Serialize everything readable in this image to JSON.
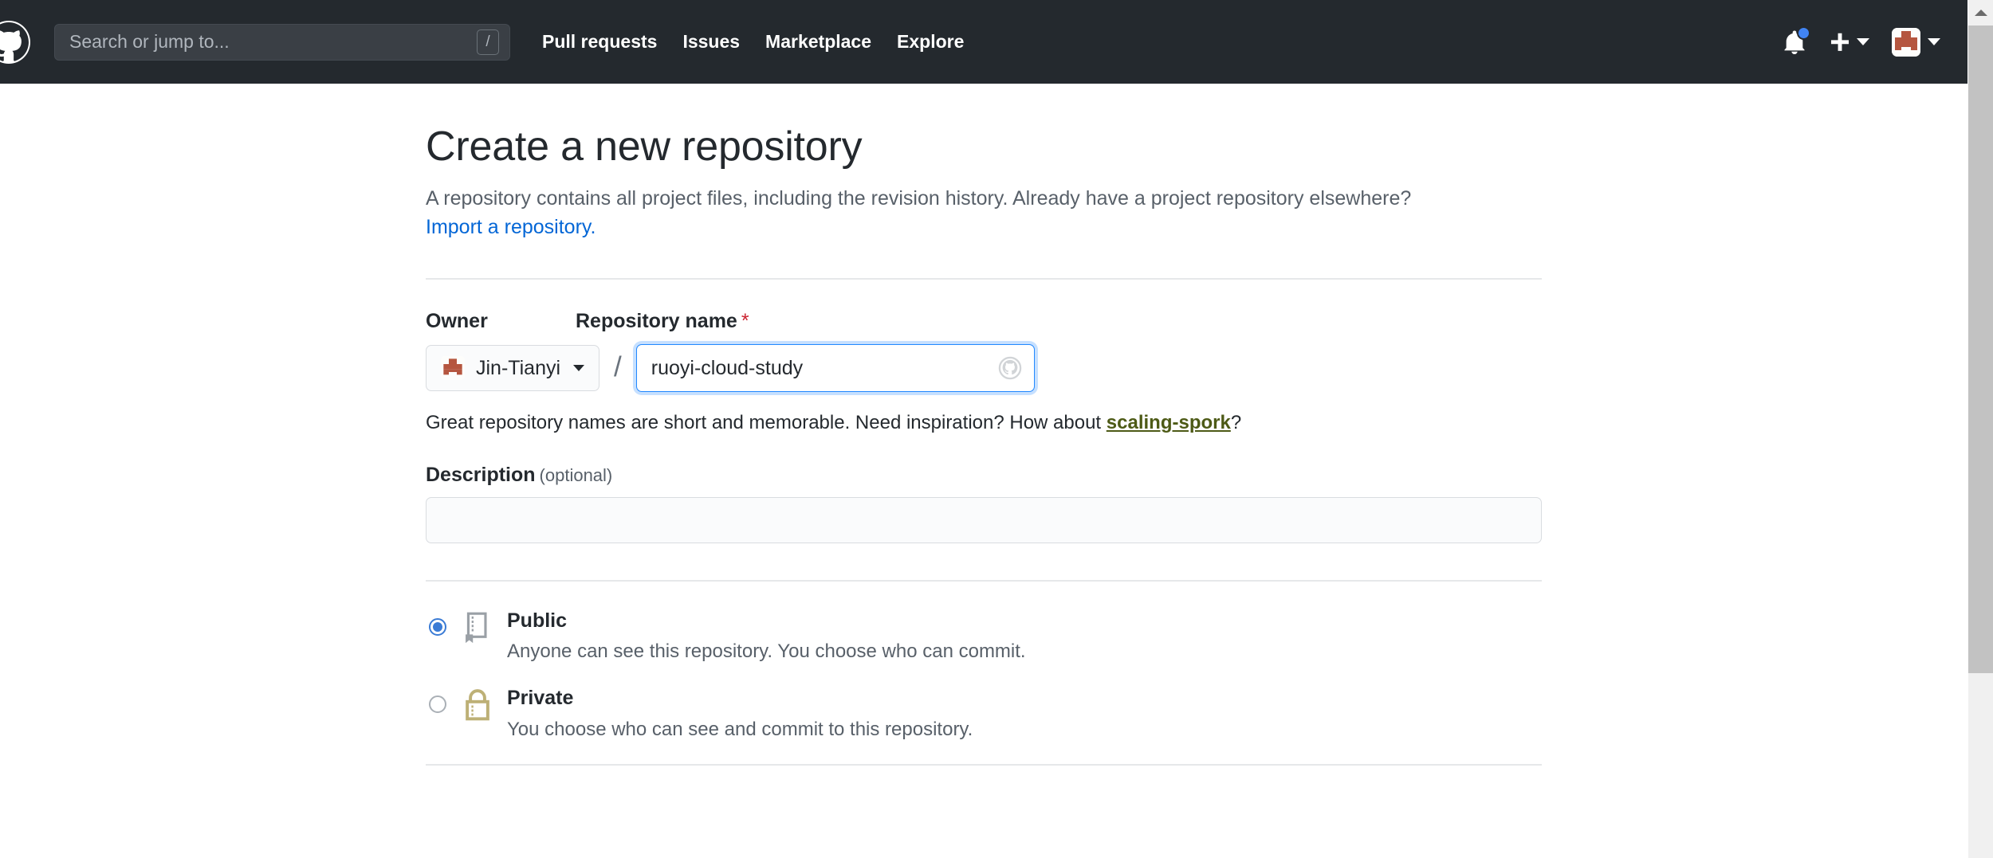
{
  "header": {
    "logo_icon": "github-octocat-logo",
    "search": {
      "placeholder": "Search or jump to...",
      "value": "",
      "shortcut_key": "/"
    },
    "nav": [
      {
        "label": "Pull requests",
        "name": "nav-pull-requests"
      },
      {
        "label": "Issues",
        "name": "nav-issues"
      },
      {
        "label": "Marketplace",
        "name": "nav-marketplace"
      },
      {
        "label": "Explore",
        "name": "nav-explore"
      }
    ],
    "notifications_icon": "bell-icon",
    "notifications_unread": true,
    "create_new_icon": "plus-icon",
    "profile_icon": "avatar-identicon",
    "colors": {
      "header_bg": "#24292e",
      "unread_dot": "#4184f3"
    }
  },
  "page": {
    "title": "Create a new repository",
    "subtitle_before_link": "A repository contains all project files, including the revision history. Already have a project repository elsewhere?",
    "import_link": "Import a repository."
  },
  "form": {
    "owner": {
      "label": "Owner",
      "selected": "Jin-Tianyi",
      "avatar_icon": "identicon-avatar",
      "caret_icon": "chevron-down-icon"
    },
    "separator": "/",
    "repo_name": {
      "label": "Repository name",
      "required_marker": "*",
      "value": "ruoyi-cloud-study",
      "placeholder": "",
      "status_icon": "octocat-spinner-icon"
    },
    "hint": {
      "prefix": "Great repository names are short and memorable. Need inspiration? How about ",
      "suggestion": "scaling-spork",
      "suffix": "?",
      "suggestion_color": "#4d5a16"
    },
    "description": {
      "label": "Description",
      "optional_note": "(optional)",
      "value": "",
      "placeholder": ""
    },
    "visibility": {
      "options": [
        {
          "name": "public",
          "title": "Public",
          "description": "Anyone can see this repository. You choose who can commit.",
          "icon": "repo-book-icon",
          "icon_color": "#9aa0a6",
          "selected": true
        },
        {
          "name": "private",
          "title": "Private",
          "description": "You choose who can see and commit to this repository.",
          "icon": "lock-icon",
          "icon_color": "#bdb076",
          "selected": false
        }
      ]
    }
  },
  "scrollbar": {
    "up_arrow_icon": "scroll-up-arrow-icon",
    "thumb_color": "#c2c2c2",
    "track_color": "#f0f0f0"
  }
}
